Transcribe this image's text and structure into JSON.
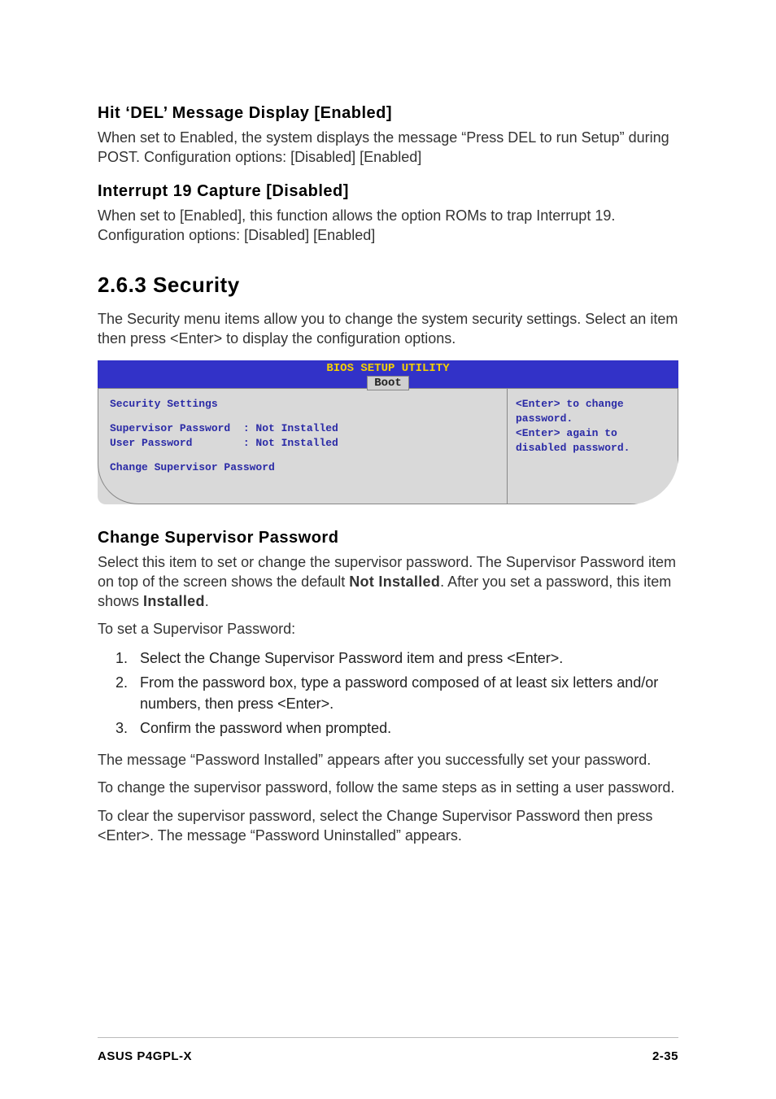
{
  "sect1": {
    "heading": "Hit ‘DEL’ Message Display [Enabled]",
    "para": "When set to Enabled, the system displays the message “Press DEL to run Setup” during POST. Configuration options: [Disabled] [Enabled]"
  },
  "sect2": {
    "heading": "Interrupt 19 Capture [Disabled]",
    "para": "When set to [Enabled], this function allows the option ROMs to trap Interrupt 19. Configuration options: [Disabled] [Enabled]"
  },
  "security": {
    "heading": "2.6.3   Security",
    "para": "The Security menu items allow you to change the system security settings. Select an item then press <Enter> to display the configuration options."
  },
  "bios": {
    "title": "BIOS SETUP UTILITY",
    "tab": "Boot",
    "left_lines": {
      "l0": "Security Settings",
      "l1": "Supervisor Password  : Not Installed",
      "l2": "User Password        : Not Installed",
      "l3": "Change Supervisor Password"
    },
    "right_lines": {
      "r0": "<Enter> to change",
      "r1": "password.",
      "r2": "<Enter> again to",
      "r3": "disabled password."
    }
  },
  "csp": {
    "heading": "Change Supervisor Password",
    "p1a": "Select this item to set or change the supervisor password. The Supervisor Password item on top of the screen shows the default ",
    "p1b": "Not Installed",
    "p1c": ". After you set a password, this item shows ",
    "p1d": "Installed",
    "p1e": ".",
    "p2": "To set a Supervisor Password:",
    "steps": {
      "s1": "Select the Change Supervisor Password item and press <Enter>.",
      "s2": "From the password box, type a password composed of at least six letters and/or numbers, then press <Enter>.",
      "s3": "Confirm the password when prompted."
    },
    "p3": "The message “Password Installed” appears after you successfully set your password.",
    "p4": "To change the supervisor password, follow the same steps as in setting a user password.",
    "p5": "To clear the supervisor password, select the Change Supervisor Password then press <Enter>. The message “Password Uninstalled” appears."
  },
  "footer": {
    "left": "ASUS P4GPL-X",
    "right": "2-35"
  }
}
